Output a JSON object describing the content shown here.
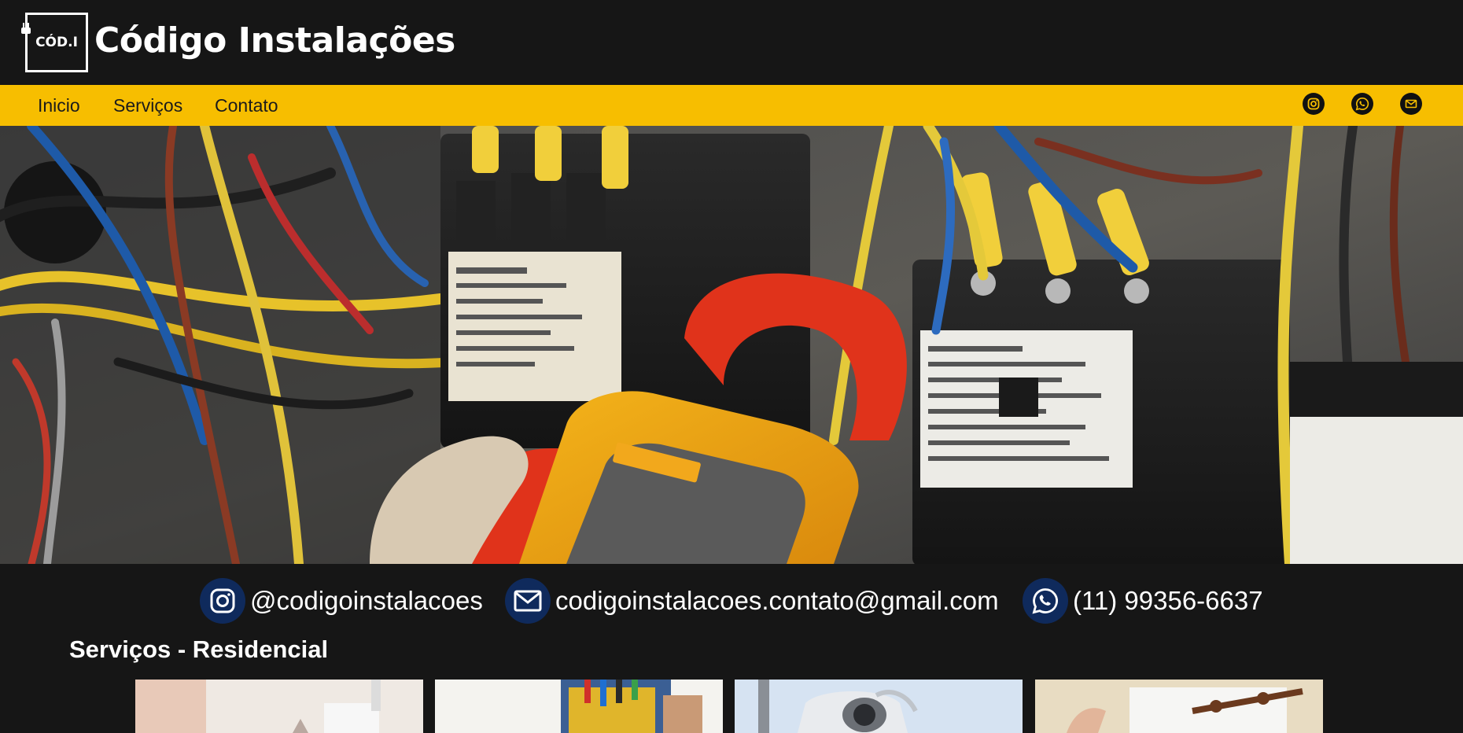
{
  "header": {
    "logo_text": "CÓD.I",
    "title": "Código Instalações"
  },
  "nav": {
    "links": [
      "Inicio",
      "Serviços",
      "Contato"
    ],
    "social_icons": [
      "instagram-icon",
      "whatsapp-icon",
      "email-icon"
    ]
  },
  "contacts": {
    "instagram": "@codigoinstalacoes",
    "email": "codigoinstalacoes.contato@gmail.com",
    "phone": "(11) 99356-6637"
  },
  "services": {
    "title": "Serviços - Residencial",
    "cards": [
      "appliance-installation-image",
      "electrician-toolbelt-image",
      "security-camera-image",
      "air-conditioner-image"
    ]
  },
  "colors": {
    "nav_bg": "#f7be00",
    "page_bg": "#161616",
    "contact_icon_bg": "#0f2a5c"
  }
}
